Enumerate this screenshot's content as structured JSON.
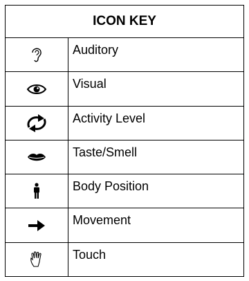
{
  "title": "ICON KEY",
  "rows": [
    {
      "icon": "ear-icon",
      "label": "Auditory"
    },
    {
      "icon": "eye-icon",
      "label": "Visual"
    },
    {
      "icon": "cycle-arrows-icon",
      "label": "Activity Level"
    },
    {
      "icon": "lips-icon",
      "label": "Taste/Smell"
    },
    {
      "icon": "standing-person-icon",
      "label": "Body Position"
    },
    {
      "icon": "right-arrow-icon",
      "label": "Movement"
    },
    {
      "icon": "hand-icon",
      "label": "Touch"
    }
  ]
}
